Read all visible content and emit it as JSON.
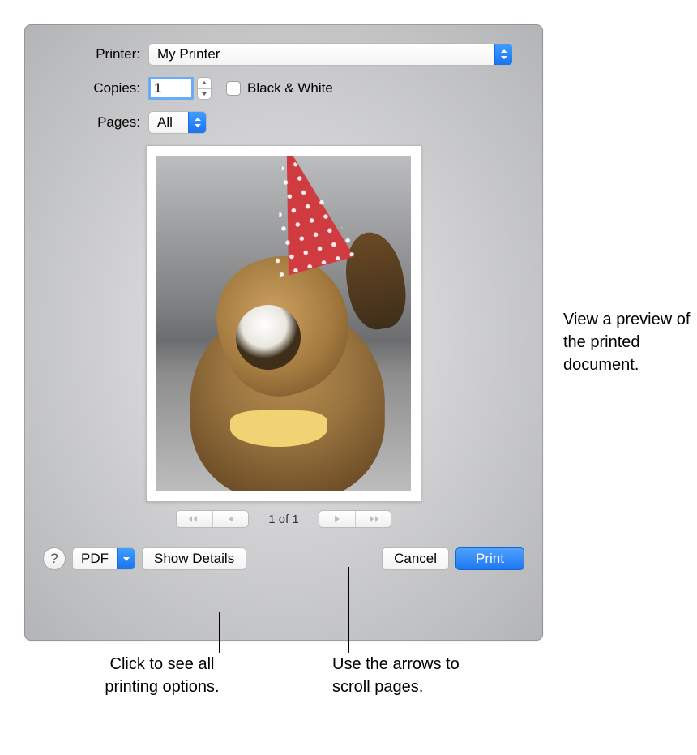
{
  "labels": {
    "printer": "Printer:",
    "copies": "Copies:",
    "pages": "Pages:",
    "bw": "Black & White"
  },
  "printer": {
    "selected": "My Printer"
  },
  "copies": {
    "value": "1"
  },
  "pages": {
    "selected": "All"
  },
  "preview": {
    "page_indicator": "1 of 1"
  },
  "buttons": {
    "help": "?",
    "pdf": "PDF",
    "show_details": "Show Details",
    "cancel": "Cancel",
    "print": "Print"
  },
  "callouts": {
    "preview": "View a preview of the printed document.",
    "details": "Click to see all printing options.",
    "arrows": "Use the arrows to scroll pages."
  }
}
